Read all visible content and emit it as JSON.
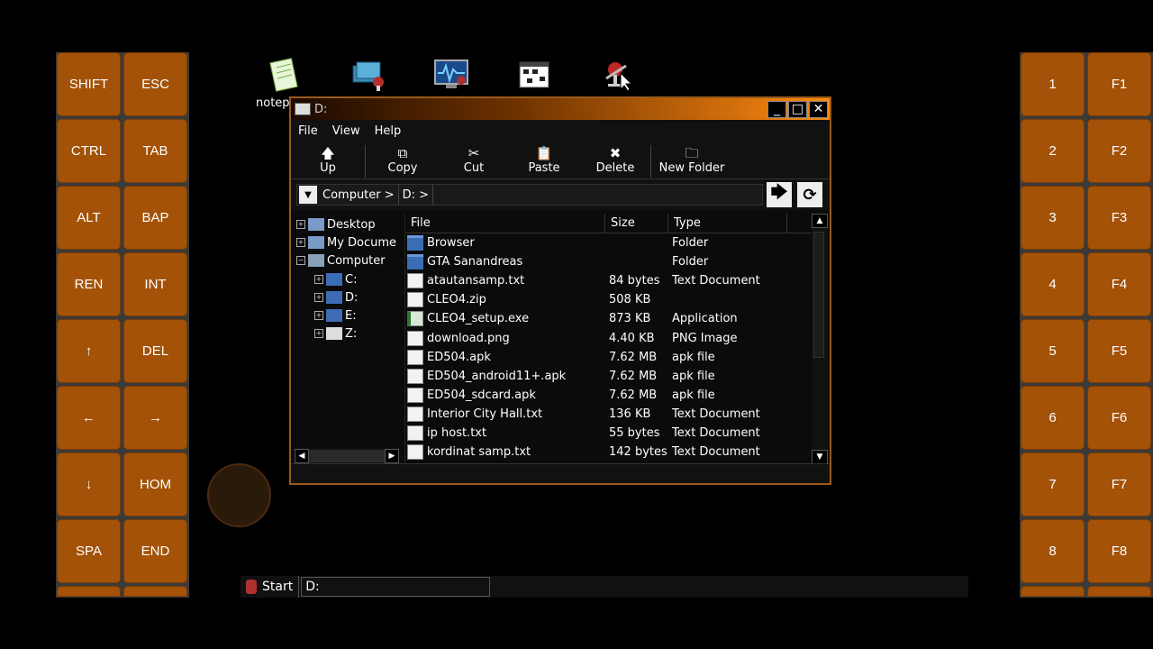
{
  "left_keys": [
    "SHIFT",
    "ESC",
    "CTRL",
    "TAB",
    "ALT",
    "BAP",
    "REN",
    "INT",
    "↑",
    "DEL",
    "←",
    "→",
    "↓",
    "HOM",
    "SPA",
    "END"
  ],
  "right_keys": [
    "1",
    "F1",
    "2",
    "F2",
    "3",
    "F3",
    "4",
    "F4",
    "5",
    "F5",
    "6",
    "F6",
    "7",
    "F7",
    "8",
    "F8"
  ],
  "desktop": {
    "label": "notep",
    "icons": [
      "notepad-icon",
      "network-icon",
      "monitor-icon",
      "matrix-icon",
      "wine-tools-icon"
    ]
  },
  "window": {
    "title": "D:",
    "controls": [
      "_",
      "□",
      "✕"
    ],
    "menu": [
      "File",
      "View",
      "Help"
    ],
    "toolbar": [
      {
        "label": "Up",
        "icon": "up-arrow-icon",
        "glyph": "🡅"
      },
      {
        "label": "Copy",
        "icon": "copy-icon",
        "glyph": "⧉"
      },
      {
        "label": "Cut",
        "icon": "cut-icon",
        "glyph": "✂"
      },
      {
        "label": "Paste",
        "icon": "paste-icon",
        "glyph": "📋"
      },
      {
        "label": "Delete",
        "icon": "delete-icon",
        "glyph": "✖"
      },
      {
        "label": "New Folder",
        "icon": "new-folder-icon",
        "glyph": "🗀"
      }
    ],
    "address": {
      "crumbs": [
        "Computer >",
        "D: >"
      ],
      "go": "🡆",
      "refresh": "⟳"
    },
    "tree": [
      {
        "label": "Desktop",
        "level": 0
      },
      {
        "label": "My Docume",
        "level": 0
      },
      {
        "label": "Computer",
        "level": 0
      },
      {
        "label": "C:",
        "level": 1
      },
      {
        "label": "D:",
        "level": 1
      },
      {
        "label": "E:",
        "level": 1
      },
      {
        "label": "Z:",
        "level": 1
      }
    ],
    "columns": [
      "File",
      "Size",
      "Type"
    ],
    "files": [
      {
        "name": "Browser",
        "size": "",
        "type": "Folder",
        "kind": "folder"
      },
      {
        "name": "GTA Sanandreas",
        "size": "",
        "type": "Folder",
        "kind": "folder"
      },
      {
        "name": "atautansamp.txt",
        "size": "84 bytes",
        "type": "Text Document",
        "kind": "doc"
      },
      {
        "name": "CLEO4.zip",
        "size": "508 KB",
        "type": "",
        "kind": "doc"
      },
      {
        "name": "CLEO4_setup.exe",
        "size": "873 KB",
        "type": "Application",
        "kind": "exe"
      },
      {
        "name": "download.png",
        "size": "4.40 KB",
        "type": "PNG Image",
        "kind": "doc"
      },
      {
        "name": "ED504.apk",
        "size": "7.62 MB",
        "type": "apk file",
        "kind": "doc"
      },
      {
        "name": "ED504_android11+.apk",
        "size": "7.62 MB",
        "type": "apk file",
        "kind": "doc"
      },
      {
        "name": "ED504_sdcard.apk",
        "size": "7.62 MB",
        "type": "apk file",
        "kind": "doc"
      },
      {
        "name": "Interior City Hall.txt",
        "size": "136 KB",
        "type": "Text Document",
        "kind": "doc"
      },
      {
        "name": "ip host.txt",
        "size": "55 bytes",
        "type": "Text Document",
        "kind": "doc"
      },
      {
        "name": "kordinat samp.txt",
        "size": "142 bytes",
        "type": "Text Document",
        "kind": "doc"
      }
    ]
  },
  "taskbar": {
    "start": "Start",
    "task": "D:"
  }
}
